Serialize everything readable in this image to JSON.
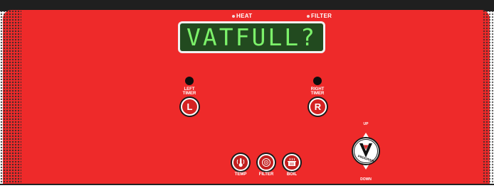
{
  "indicators": {
    "heat": "HEAT",
    "filter": "FILTER"
  },
  "display": {
    "text": "VATFULL?"
  },
  "timers": {
    "left": {
      "label_line1": "LEFT",
      "label_line2": "TIMER",
      "button": "L"
    },
    "right": {
      "label_line1": "RIGHT",
      "label_line2": "TIMER",
      "button": "R"
    }
  },
  "buttons": {
    "temp": {
      "label": "TEMP",
      "icon": "thermometer-icon"
    },
    "filter": {
      "label": "FILTER",
      "icon": "filter-icon"
    },
    "boil": {
      "label": "BOIL",
      "icon": "boil-icon"
    }
  },
  "program": {
    "up": "UP",
    "down": "DOWN",
    "center_label": "PROGRAM",
    "letter": "V"
  },
  "colors": {
    "panel": "#ee2a2a",
    "display_bg": "#224a1f",
    "display_text": "#7cf26a"
  }
}
